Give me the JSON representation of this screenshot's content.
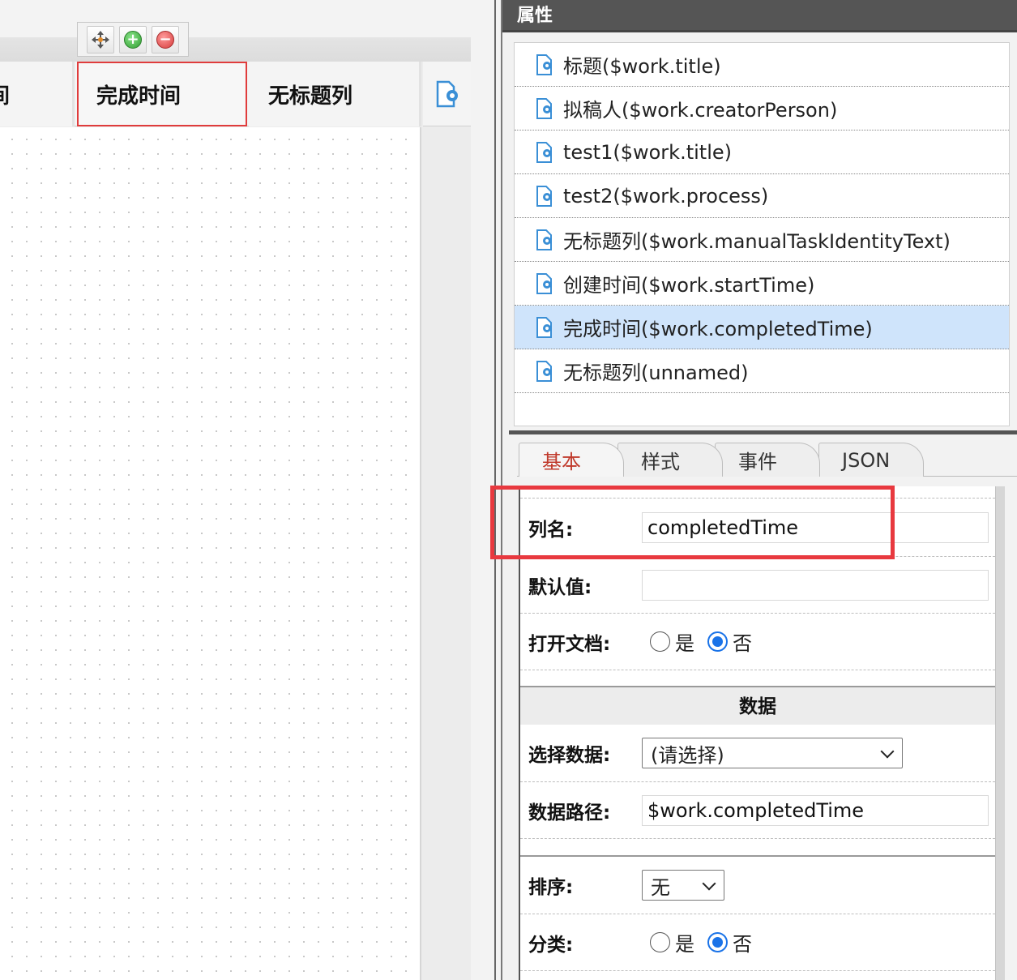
{
  "canvas": {
    "toolbar": {
      "move_icon": "move-arrows-icon",
      "add_icon": "add-circle-icon",
      "remove_icon": "remove-circle-icon"
    },
    "columns": [
      {
        "label": "间",
        "selected": false
      },
      {
        "label": "完成时间",
        "selected": true
      },
      {
        "label": "无标题列",
        "selected": false
      }
    ],
    "add_column_icon": "add-document-icon"
  },
  "panel": {
    "title": "属性",
    "column_list": [
      {
        "label": "标题($work.title)",
        "selected": false
      },
      {
        "label": "拟稿人($work.creatorPerson)",
        "selected": false
      },
      {
        "label": "test1($work.title)",
        "selected": false
      },
      {
        "label": "test2($work.process)",
        "selected": false
      },
      {
        "label": "无标题列($work.manualTaskIdentityText)",
        "selected": false
      },
      {
        "label": "创建时间($work.startTime)",
        "selected": false
      },
      {
        "label": "完成时间($work.completedTime)",
        "selected": true
      },
      {
        "label": "无标题列(unnamed)",
        "selected": false
      }
    ],
    "tabs": [
      {
        "label": "基本",
        "active": true
      },
      {
        "label": "样式",
        "active": false
      },
      {
        "label": "事件",
        "active": false
      },
      {
        "label": "JSON",
        "active": false
      }
    ],
    "form": {
      "column_name": {
        "label": "列名:",
        "value": "completedTime"
      },
      "default_value": {
        "label": "默认值:",
        "value": ""
      },
      "open_document": {
        "label": "打开文档:",
        "yes": "是",
        "no": "否",
        "selected": "no"
      },
      "data_section_title": "数据",
      "select_data": {
        "label": "选择数据:",
        "value": "(请选择)"
      },
      "data_path": {
        "label": "数据路径:",
        "value": "$work.completedTime"
      },
      "sort": {
        "label": "排序:",
        "value": "无"
      },
      "category": {
        "label": "分类:",
        "yes": "是",
        "no": "否",
        "selected": "no"
      }
    }
  },
  "colors": {
    "header_bg": "#555555",
    "selected_row": "#cfe4fb",
    "highlight": "#e8393f",
    "radio_on": "#1a73e8",
    "active_tab": "#c0392b"
  }
}
